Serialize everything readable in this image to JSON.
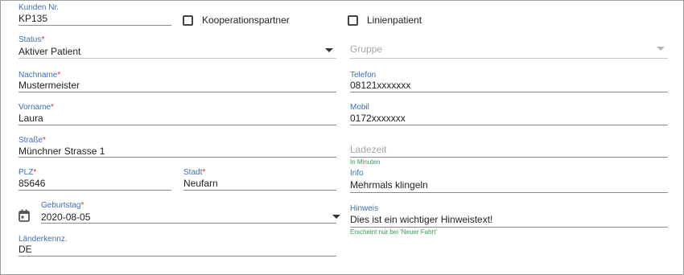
{
  "customer_no": {
    "label": "Kunden Nr.",
    "value": "KP135"
  },
  "cooperation_partner": {
    "label": "Kooperationspartner",
    "checked": false
  },
  "line_patient": {
    "label": "Linienpatient",
    "checked": false
  },
  "status": {
    "label": "Status",
    "required_mark": "*",
    "value": "Aktiver Patient"
  },
  "group": {
    "placeholder": "Gruppe"
  },
  "last_name": {
    "label": "Nachname",
    "required_mark": "*",
    "value": "Mustermeister"
  },
  "phone": {
    "label": "Telefon",
    "value": "08121xxxxxxx"
  },
  "first_name": {
    "label": "Vorname",
    "required_mark": "*",
    "value": "Laura"
  },
  "mobile": {
    "label": "Mobil",
    "value": "0172xxxxxxx"
  },
  "street": {
    "label": "Straße",
    "required_mark": "*",
    "value": "Münchner Strasse 1"
  },
  "loading_time": {
    "placeholder": "Ladezeit",
    "hint": "In Minuten"
  },
  "zip": {
    "label": "PLZ",
    "required_mark": "*",
    "value": "85646"
  },
  "city": {
    "label": "Stadt",
    "required_mark": "*",
    "value": "Neufarn"
  },
  "info": {
    "label": "Info",
    "value": "Mehrmals klingeln"
  },
  "birthday": {
    "label": "Geburtstag",
    "required_mark": "*",
    "value": "2020-08-05",
    "icon": "calendar-icon"
  },
  "note": {
    "label": "Hinweis",
    "value": "Dies ist ein wichtiger Hinweistext!",
    "hint": "Erscheint nur bei 'Neuer Fahrt'"
  },
  "country_code": {
    "label": "Länderkennz.",
    "value": "DE"
  },
  "colors": {
    "label_blue": "#3f6fb5",
    "required_red": "#d32f2f",
    "hint_green": "#2e9b57"
  }
}
